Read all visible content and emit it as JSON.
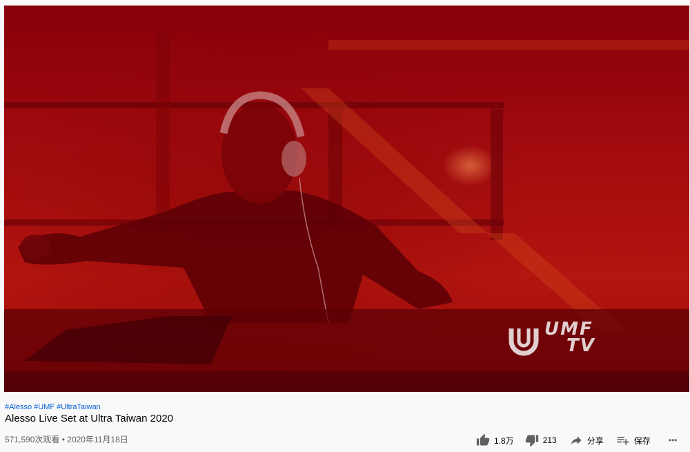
{
  "video": {
    "watermark_line1": "UMF",
    "watermark_line2": "TV"
  },
  "hashtags": [
    "#Alesso",
    "#UMF",
    "#UltraTaiwan"
  ],
  "title": "Alesso Live Set at Ultra Taiwan 2020",
  "meta": {
    "views": "571,590次观看",
    "separator": "•",
    "date": "2020年11月18日"
  },
  "actions": {
    "like_count": "1.8万",
    "dislike_count": "213",
    "share_label": "分享",
    "save_label": "保存",
    "more_label": "•••"
  },
  "colors": {
    "video_tint": "#a10a0e",
    "link": "#065fd4",
    "text": "#030303",
    "secondary": "#606060"
  }
}
